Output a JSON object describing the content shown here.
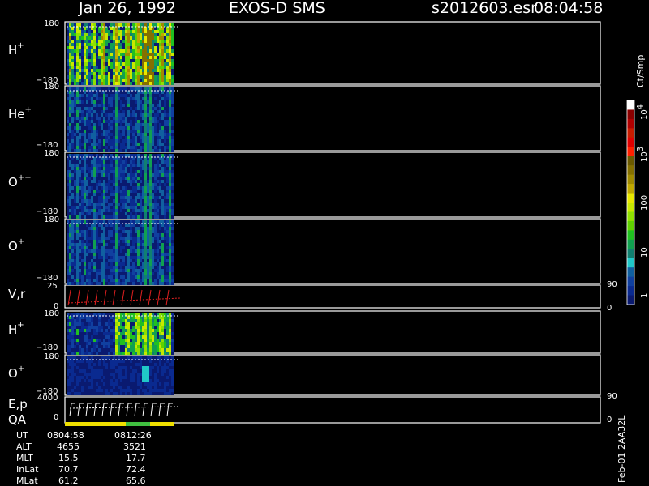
{
  "header": {
    "date": "Jan 26, 1992",
    "instrument": "EXOS-D SMS",
    "file": "s2012603.esr",
    "time": "08:04:58"
  },
  "colorbar": {
    "unit": "Ct/Smp",
    "tick_labels": [
      "10",
      "10",
      "100",
      "10",
      "1"
    ],
    "tick_exponents": [
      "4",
      "3",
      "",
      "",
      ""
    ],
    "colors": [
      "#ffffff",
      "#8b0000",
      "#b00000",
      "#c81c00",
      "#e00000",
      "#ff2000",
      "#6b5a00",
      "#857000",
      "#a08a00",
      "#c0a800",
      "#e8e800",
      "#c8e800",
      "#90e000",
      "#60d000",
      "#20c020",
      "#10a050",
      "#108070",
      "#20c8c8",
      "#1060a0",
      "#1040a0",
      "#0a2a90",
      "#0a1a70"
    ],
    "range": [
      1,
      10000
    ],
    "scale": "log"
  },
  "panels": [
    {
      "label": "H",
      "sup": "+",
      "ymax": "180",
      "ymin": "−180",
      "type": "spectrogram"
    },
    {
      "label": "He",
      "sup": "+",
      "ymax": "180",
      "ymin": "−180",
      "type": "spectrogram"
    },
    {
      "label": "O",
      "sup": "++",
      "ymax": "180",
      "ymin": "−180",
      "type": "spectrogram"
    },
    {
      "label": "O",
      "sup": "+",
      "ymax": "180",
      "ymin": "−180",
      "type": "spectrogram"
    },
    {
      "label": "V,r",
      "sup": "",
      "ymax": "25",
      "ymin": "0",
      "right_max": "90",
      "right_min": "0",
      "type": "line"
    },
    {
      "label": "H",
      "sup": "+",
      "ymax": "180",
      "ymin": "−180",
      "type": "spectrogram"
    },
    {
      "label": "O",
      "sup": "+",
      "ymax": "180",
      "ymin": "−180",
      "type": "spectrogram"
    },
    {
      "label": "E,p",
      "sup": "",
      "ymax": "4000",
      "ymin": "0",
      "right_max": "90",
      "right_min": "0",
      "type": "line"
    }
  ],
  "qa_label": "QA",
  "qa_colors": [
    "#f0e000",
    "#40c040"
  ],
  "vertical_label": "Feb-01 2AA32L",
  "orbit_table": {
    "rows": [
      {
        "name": "UT",
        "v1": "0804:58",
        "v2": "0812:26"
      },
      {
        "name": "ALT",
        "v1": "4655",
        "v2": "3521"
      },
      {
        "name": "MLT",
        "v1": "15.5",
        "v2": "17.7"
      },
      {
        "name": "InLat",
        "v1": "70.7",
        "v2": "72.4"
      },
      {
        "name": "MLat",
        "v1": "61.2",
        "v2": "65.6"
      }
    ]
  },
  "chart_data": {
    "type": "heatmap",
    "x_range": [
      "0804:58",
      "0812:26"
    ],
    "y_range": [
      -180,
      180
    ],
    "ylabel": "",
    "colorscale_units": "Ct/Smp",
    "panels": [
      "H+",
      "He+",
      "O++",
      "O+",
      "V,r",
      "H+",
      "O+",
      "E,p"
    ]
  }
}
